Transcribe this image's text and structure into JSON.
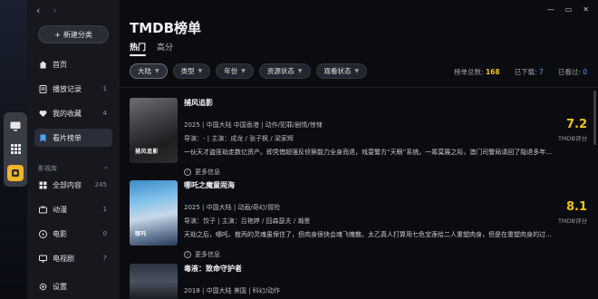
{
  "sidebar": {
    "new_category": "新建分类",
    "items": [
      {
        "label": "首页",
        "count": ""
      },
      {
        "label": "播放记录",
        "count": "1"
      },
      {
        "label": "我的收藏",
        "count": "4"
      },
      {
        "label": "看片榜单",
        "count": ""
      }
    ],
    "section": "影视库",
    "library": [
      {
        "label": "全部内容",
        "count": "245"
      },
      {
        "label": "动漫",
        "count": "1"
      },
      {
        "label": "电影",
        "count": "0"
      },
      {
        "label": "电视剧",
        "count": "7"
      }
    ],
    "settings": "设置"
  },
  "header": {
    "title": "TMDB榜单",
    "tabs": [
      "热门",
      "高分"
    ]
  },
  "filters": [
    "大陆",
    "类型",
    "年份",
    "资源状态",
    "观看状态"
  ],
  "stats": {
    "total_label": "榜单总数:",
    "total_value": "168",
    "downloaded_label": "已下载:",
    "downloaded_value": "7",
    "watched_label": "已看过:",
    "watched_value": "0"
  },
  "movies": [
    {
      "title": "捕风追影",
      "poster_text": "捕风追影",
      "meta": "2025  |  中国大陆 中国香港  |  动作/犯罪/剧情/惊悚",
      "cast": "导演：- | 主演：成龙 / 张子枫 / 梁家辉",
      "desc": "一伙天才盗匪劫走数亿资产。即凭借超强反侦察能力全身而退，戏耍警方“天眼”系统。一筹莫展之际，澳门司警局请回了隐退多年的…",
      "more": "更多信息",
      "score": "7.2",
      "score_label": "TMDB评分"
    },
    {
      "title": "哪吒之魔童闹海",
      "poster_text": "哪吒",
      "meta": "2025  |  中国大陆  |  动画/奇幻/冒险",
      "cast": "导演：饺子 | 主演：吕艳婷 / 囧森瑟夫 / 瀚墨",
      "desc": "天劫之后，哪吒、敖丙的灵魂虽保住了，但肉身很快会魂飞魄散。太乙真人打算用七色宝莲给二人重塑肉身，但是在重塑肉身的过程中…",
      "more": "更多信息",
      "score": "8.1",
      "score_label": "TMDB评分"
    },
    {
      "title": "毒液：致命守护者",
      "meta": "2018  |  中国大陆 美国  |  科幻/动作"
    }
  ],
  "window": {
    "minimize": "—",
    "maximize": "▭",
    "close": "✕"
  }
}
